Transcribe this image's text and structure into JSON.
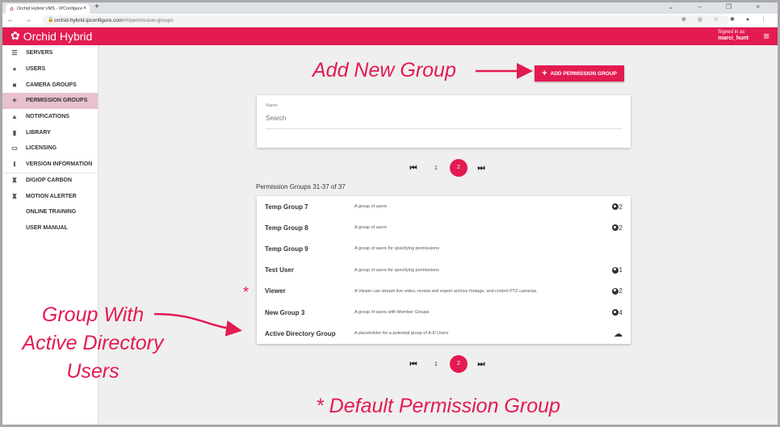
{
  "browser": {
    "tab_title": "Orchid Hybrid VMS - IPConfigure",
    "url_host": "orchid-hybrid.ipconfigure.com",
    "url_path": "/#!/permission-groups"
  },
  "header": {
    "brand": "Orchid Hybrid",
    "signed_in_label": "Signed in as",
    "username": "marci_hunt"
  },
  "sidebar": {
    "items": [
      {
        "label": "SERVERS",
        "icon": "☰"
      },
      {
        "label": "USERS",
        "icon": "●"
      },
      {
        "label": "CAMERA GROUPS",
        "icon": "■"
      },
      {
        "label": "PERMISSION GROUPS",
        "icon": "✦"
      },
      {
        "label": "NOTIFICATIONS",
        "icon": "▲"
      },
      {
        "label": "LIBRARY",
        "icon": "▮"
      },
      {
        "label": "LICENSING",
        "icon": "▭"
      },
      {
        "label": "VERSION INFORMATION",
        "icon": "ℹ"
      },
      {
        "label": "DIGIOP CARBON",
        "icon": "♜"
      },
      {
        "label": "MOTION ALERTER",
        "icon": "♜"
      },
      {
        "label": "ONLINE TRAINING",
        "icon": ""
      },
      {
        "label": "USER MANUAL",
        "icon": ""
      }
    ]
  },
  "main": {
    "add_button": "ADD PERMISSION GROUP",
    "search_label": "Name",
    "search_placeholder": "Search",
    "pages": [
      "1",
      "2"
    ],
    "current_page": "2",
    "count_text": "Permission Groups 31-37 of 37",
    "groups": [
      {
        "name": "Temp Group 7",
        "description": "A group of users",
        "count": "2"
      },
      {
        "name": "Temp Group 8",
        "description": "A group of users",
        "count": "2"
      },
      {
        "name": "Temp Group 9",
        "description": "A group of users for specifying permissions",
        "count": ""
      },
      {
        "name": "Test User",
        "description": "A group of users for specifying permissions",
        "count": "1"
      },
      {
        "name": "Viewer",
        "description": "A Viewer can stream live video, review and export archive footage, and control PTZ cameras.",
        "count": "2"
      },
      {
        "name": "New Group 3",
        "description": "A group of users with Member Groups",
        "count": "4"
      },
      {
        "name": "Active Directory Group",
        "description": "A placeholder for a potential group of A-D Users",
        "count": ""
      }
    ]
  },
  "annotations": {
    "add_new_group": "Add New Group",
    "ad_group_1": "Group With",
    "ad_group_2": "Active Directory",
    "ad_group_3": "Users",
    "default_star": "*",
    "default_group": "* Default Permission Group"
  }
}
